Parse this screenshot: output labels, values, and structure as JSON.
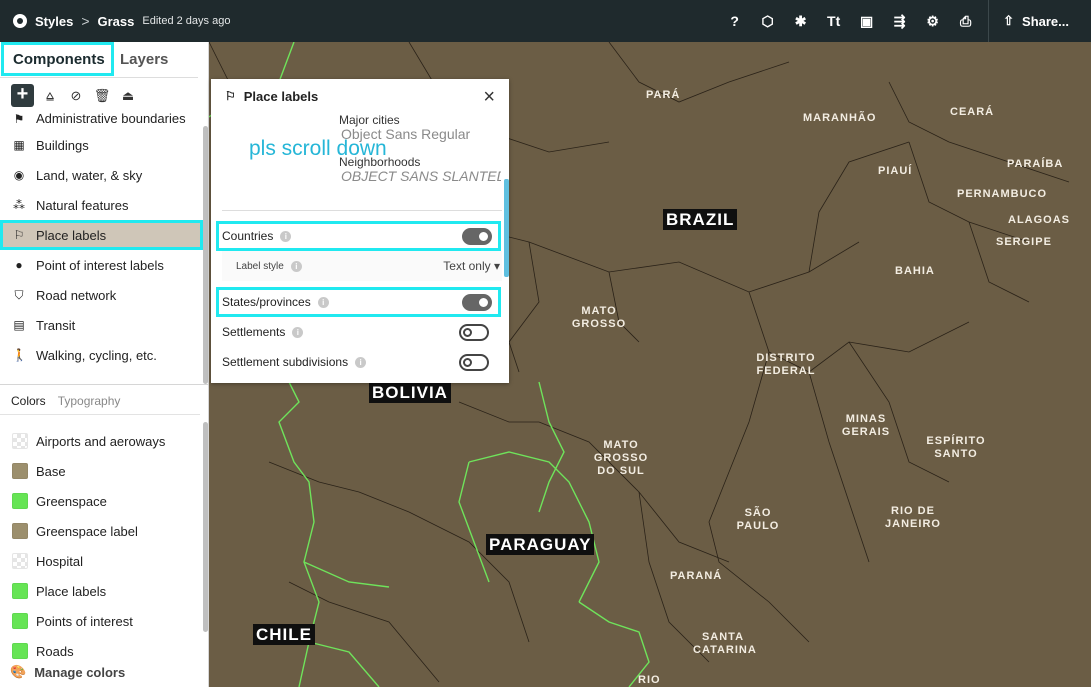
{
  "topbar": {
    "crumb_styles": "Styles",
    "crumb_sep": ">",
    "crumb_style": "Grass",
    "edited": "Edited 2 days ago",
    "share_label": "Share...",
    "tool_glyphs": {
      "help": "?",
      "box": "⬡",
      "bug": "✱",
      "text": "Tt",
      "image": "▣",
      "export": "⇶",
      "settings": "⚙",
      "print": "⎙",
      "share": "⇧"
    }
  },
  "sidebar": {
    "tabs": [
      "Components",
      "Layers"
    ],
    "add_label": "+",
    "components": [
      {
        "label": "Administrative boundaries",
        "icon": "flag-icon"
      },
      {
        "label": "Buildings",
        "icon": "building-icon"
      },
      {
        "label": "Land, water, & sky",
        "icon": "globe-icon"
      },
      {
        "label": "Natural features",
        "icon": "tree-icon"
      },
      {
        "label": "Place labels",
        "icon": "place-label-icon"
      },
      {
        "label": "Point of interest labels",
        "icon": "pin-icon"
      },
      {
        "label": "Road network",
        "icon": "road-icon"
      },
      {
        "label": "Transit",
        "icon": "train-icon"
      },
      {
        "label": "Walking, cycling, etc.",
        "icon": "walk-icon"
      }
    ],
    "subtabs": [
      "Colors",
      "Typography"
    ],
    "colors": [
      {
        "label": "Airports and aeroways",
        "color": "checker"
      },
      {
        "label": "Base",
        "color": "#9c8f6d"
      },
      {
        "label": "Greenspace",
        "color": "#66e455"
      },
      {
        "label": "Greenspace label",
        "color": "#9c8f6d"
      },
      {
        "label": "Hospital",
        "color": "checker"
      },
      {
        "label": "Place labels",
        "color": "#66e455"
      },
      {
        "label": "Points of interest",
        "color": "#66e455"
      },
      {
        "label": "Roads",
        "color": "#66e455"
      }
    ],
    "manage_label": "Manage colors"
  },
  "popup": {
    "title": "Place labels",
    "close": "×",
    "preview": {
      "note": "pls scroll down",
      "major_cities": "Major cities",
      "major_font": "Object Sans Regular",
      "neighborhoods": "Neighborhoods",
      "neighborhoods_font": "OBJECT SANS SLANTED"
    },
    "countries_label": "Countries",
    "label_style_label": "Label style",
    "label_style_value": "Text only",
    "states_label": "States/provinces",
    "settlements_label": "Settlements",
    "subdivisions_label": "Settlement subdivisions",
    "info": "i"
  },
  "map": {
    "countries": [
      "BRAZIL",
      "BOLIVIA",
      "PARAGUAY",
      "CHILE"
    ],
    "states": {
      "para": "PARÁ",
      "maranhao": "MARANHÃO",
      "ceara": "CEARÁ",
      "paraiba": "PARAÍBA",
      "piaui": "PIAUÍ",
      "pernambuco": "PERNAMBUCO",
      "alagoas": "ALAGOAS",
      "sergipe": "SERGIPE",
      "bahia": "BAHIA",
      "mato_grosso_1": "MATO",
      "mato_grosso_2": "GROSSO",
      "df_1": "DISTRITO",
      "df_2": "FEDERAL",
      "mg_1": "MINAS",
      "mg_2": "GERAIS",
      "es_1": "ESPÍRITO",
      "es_2": "SANTO",
      "ms_1": "MATO",
      "ms_2": "GROSSO",
      "ms_3": "DO SUL",
      "sp_1": "SÃO",
      "sp_2": "PAULO",
      "rj_1": "RIO DE",
      "rj_2": "JANEIRO",
      "parana": "PARANÁ",
      "sc_1": "SANTA",
      "sc_2": "CATARINA",
      "rio": "RIO"
    }
  }
}
